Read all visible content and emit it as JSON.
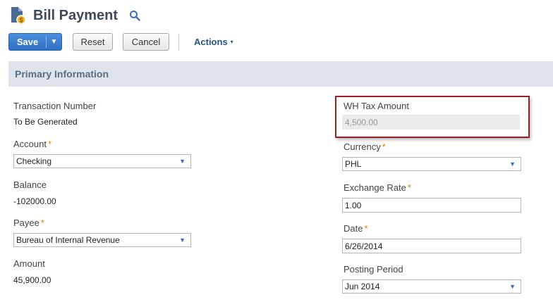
{
  "header": {
    "title": "Bill Payment",
    "page_icon": "document-dollar-icon",
    "search_icon": "search-icon"
  },
  "toolbar": {
    "save_label": "Save",
    "save_dropdown_glyph": "▼",
    "reset_label": "Reset",
    "cancel_label": "Cancel",
    "actions_label": "Actions",
    "actions_caret": "▾"
  },
  "section": {
    "title": "Primary Information"
  },
  "left_fields": {
    "transaction_number": {
      "label": "Transaction Number",
      "value": "To Be Generated"
    },
    "account": {
      "label": "Account",
      "required_mark": "*",
      "value": "Checking"
    },
    "balance": {
      "label": "Balance",
      "value": "-102000.00"
    },
    "payee": {
      "label": "Payee",
      "required_mark": "*",
      "value": "Bureau of Internal Revenue"
    },
    "amount": {
      "label": "Amount",
      "value": "45,900.00"
    }
  },
  "right_fields": {
    "wh_tax_amount": {
      "label": "WH Tax Amount",
      "value": "4,500.00"
    },
    "currency": {
      "label": "Currency",
      "required_mark": "*",
      "value": "PHL"
    },
    "exchange_rate": {
      "label": "Exchange Rate",
      "required_mark": "*",
      "value": "1.00"
    },
    "date": {
      "label": "Date",
      "required_mark": "*",
      "value": "6/26/2014"
    },
    "posting_period": {
      "label": "Posting Period",
      "value": "Jun 2014"
    }
  },
  "colors": {
    "primary_button": "#2f6fc4",
    "highlight_box": "#9b2026",
    "section_bg": "#dfe4eb",
    "required_mark": "#d88a00"
  }
}
